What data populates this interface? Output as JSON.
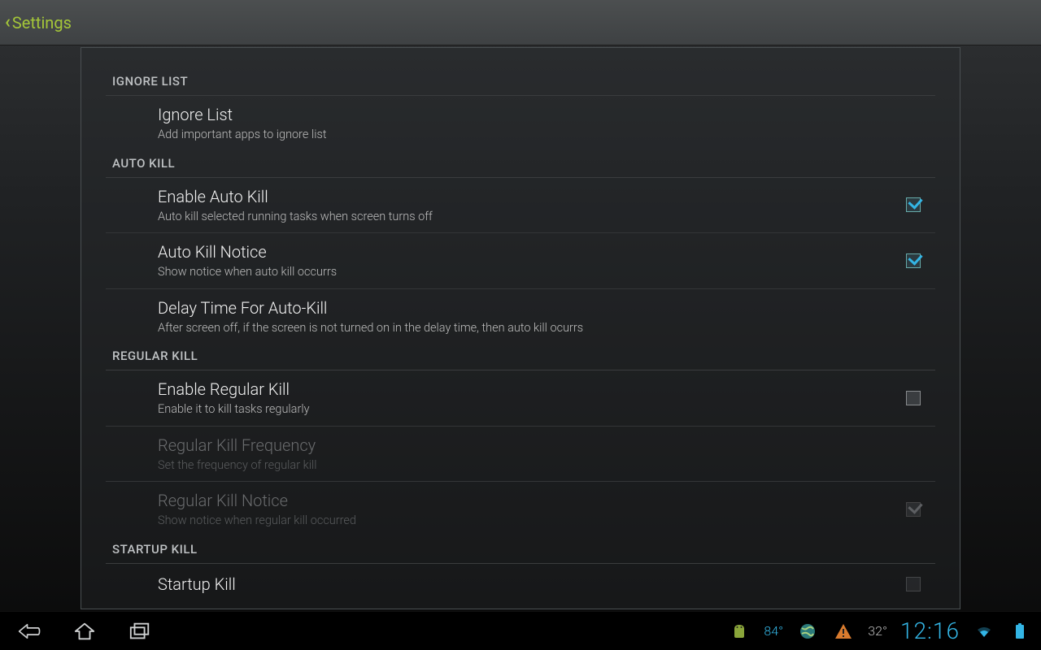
{
  "header": {
    "title": "Settings"
  },
  "sections": {
    "ignore": {
      "header": "IGNORE LIST",
      "item1": {
        "title": "Ignore List",
        "sub": "Add important apps to ignore list"
      }
    },
    "auto": {
      "header": "AUTO KILL",
      "enable": {
        "title": "Enable Auto Kill",
        "sub": "Auto kill selected running tasks when screen turns off",
        "checked": true
      },
      "notice": {
        "title": "Auto Kill Notice",
        "sub": "Show notice when auto kill occurrs",
        "checked": true
      },
      "delay": {
        "title": "Delay Time For Auto-Kill",
        "sub": "After screen off, if the screen is not turned on in the delay time, then auto kill ocurrs"
      }
    },
    "regular": {
      "header": "REGULAR KILL",
      "enable": {
        "title": "Enable Regular Kill",
        "sub": "Enable it to kill tasks regularly",
        "checked": false
      },
      "freq": {
        "title": "Regular Kill Frequency",
        "sub": "Set the frequency of regular kill",
        "enabled": false
      },
      "notice": {
        "title": "Regular Kill Notice",
        "sub": "Show notice when regular kill occurred",
        "enabled": false,
        "checked": true
      }
    },
    "startup": {
      "header": "STARTUP KILL",
      "item": {
        "title": "Startup Kill"
      }
    }
  },
  "status": {
    "temp1": "84°",
    "temp2": "32°",
    "clock": "12:16"
  }
}
